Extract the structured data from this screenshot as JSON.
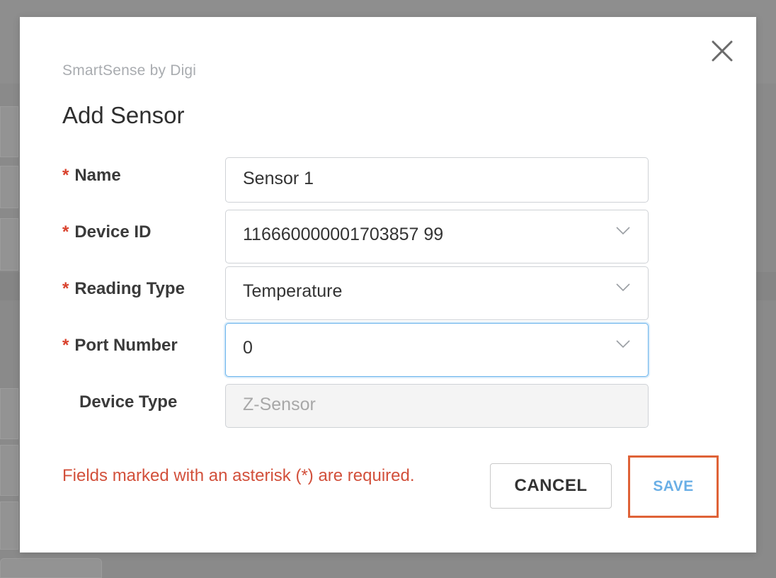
{
  "modal": {
    "brand": "SmartSense by Digi",
    "title": "Add Sensor",
    "close_icon": "close-icon",
    "fields": {
      "name": {
        "required_mark": "*",
        "label": "Name",
        "value": "Sensor 1"
      },
      "device_id": {
        "required_mark": "*",
        "label": "Device ID",
        "value": "116660000001703857 99"
      },
      "reading_type": {
        "required_mark": "*",
        "label": "Reading Type",
        "value": "Temperature"
      },
      "port_number": {
        "required_mark": "*",
        "label": "Port Number",
        "value": "0"
      },
      "device_type": {
        "label": "Device Type",
        "value": "Z-Sensor"
      }
    },
    "required_note": "Fields marked with an asterisk (*) are required.",
    "buttons": {
      "cancel": "CANCEL",
      "save": "SAVE"
    }
  },
  "colors": {
    "required": "#d9412c",
    "save_text": "#6aafe6",
    "save_highlight": "#df6237",
    "focus_border": "#6ab4ec"
  }
}
